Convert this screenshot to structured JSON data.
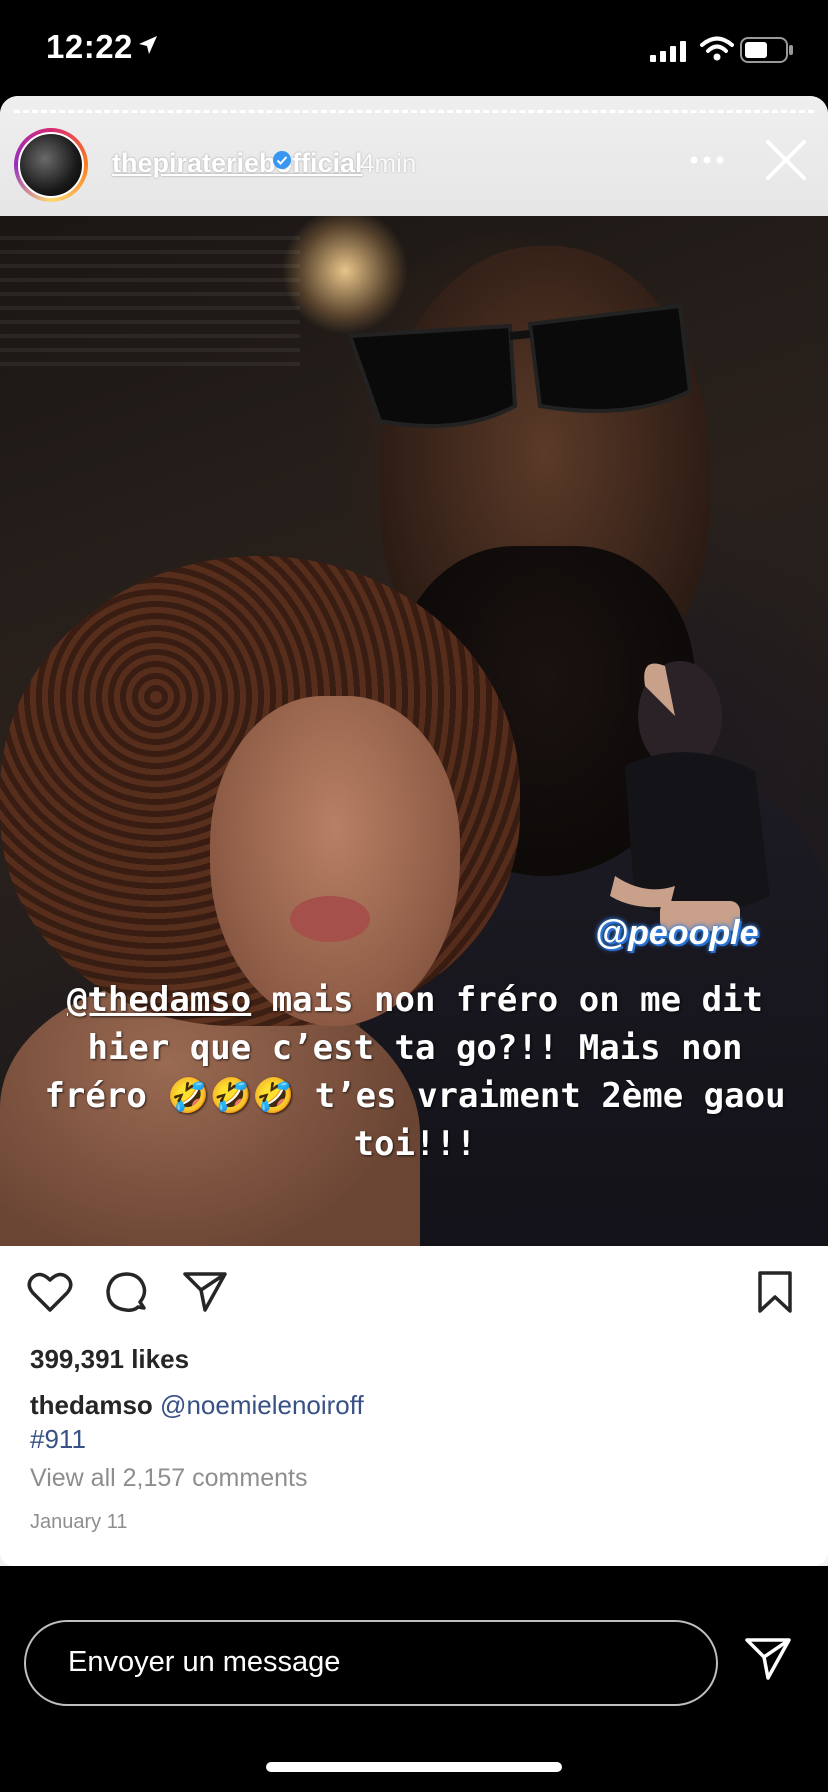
{
  "status_bar": {
    "time": "12:22",
    "icons": [
      "location-arrow-icon",
      "signal-icon",
      "wifi-icon",
      "battery-icon"
    ]
  },
  "story": {
    "username": "thepirateriebofficial",
    "verified": true,
    "time_ago": "4min",
    "actions": [
      "more-icon",
      "close-icon"
    ]
  },
  "image": {
    "sticker_brand": "@peoople",
    "caption_mention": "@thedamso",
    "caption_text": " mais non fréro on me dit hier que c’est ta go?!! Mais non fréro 🤣🤣🤣 t’es vraiment 2ème gaou toi!!!"
  },
  "post": {
    "likes": "399,391 likes",
    "caption_user": "thedamso",
    "caption_mention": "@noemielenoiroff",
    "caption_hashtag": "#911",
    "view_comments": "View all 2,157 comments",
    "date": "January 11",
    "action_icons": [
      "heart-icon",
      "comment-icon",
      "share-icon",
      "bookmark-icon"
    ]
  },
  "message_bar": {
    "placeholder": "Envoyer un message"
  },
  "colors": {
    "link": "#385185",
    "meta_text": "#8e8e8e",
    "sticker_glow": "#2f7fe0"
  }
}
